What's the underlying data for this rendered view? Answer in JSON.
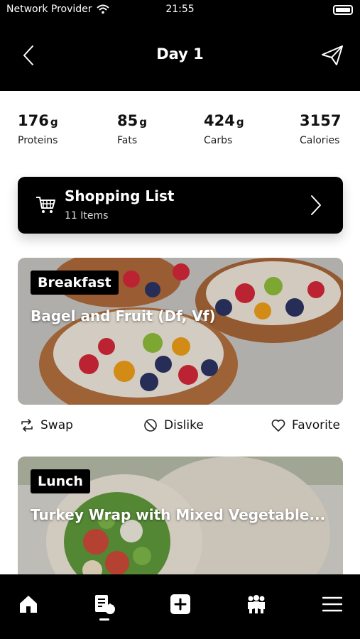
{
  "status": {
    "provider": "Network Provider",
    "time": "21:55"
  },
  "header": {
    "title": "Day 1",
    "back_icon": "chevron-left-icon",
    "send_icon": "paper-plane-icon"
  },
  "macros": [
    {
      "value": "176",
      "unit": "g",
      "label": "Proteins"
    },
    {
      "value": "85",
      "unit": "g",
      "label": "Fats"
    },
    {
      "value": "424",
      "unit": "g",
      "label": "Carbs"
    },
    {
      "value": "3157",
      "unit": "",
      "label": "Calories"
    }
  ],
  "shopping": {
    "title": "Shopping List",
    "subtitle": "11 Items",
    "icon": "cart-icon"
  },
  "meals": [
    {
      "tag": "Breakfast",
      "name": "Bagel and Fruit (Df, Vf)"
    },
    {
      "tag": "Lunch",
      "name": "Turkey Wrap with Mixed Vegetable..."
    }
  ],
  "actions": {
    "swap": "Swap",
    "dislike": "Dislike",
    "favorite": "Favorite"
  },
  "nav": [
    "home-icon",
    "meal-plan-icon",
    "add-icon",
    "community-icon",
    "menu-icon"
  ]
}
